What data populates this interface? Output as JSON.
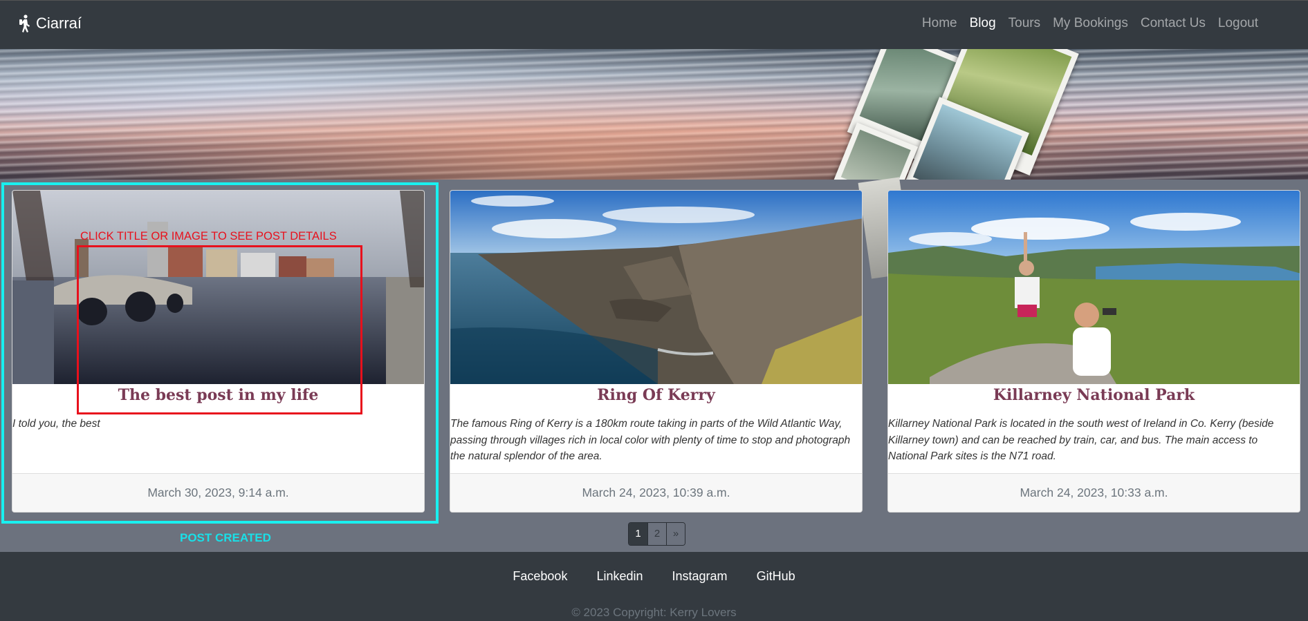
{
  "navbar": {
    "brand": "Ciarraí",
    "links": [
      {
        "label": "Home",
        "active": false
      },
      {
        "label": "Blog",
        "active": true
      },
      {
        "label": "Tours",
        "active": false
      },
      {
        "label": "My Bookings",
        "active": false
      },
      {
        "label": "Contact Us",
        "active": false
      },
      {
        "label": "Logout",
        "active": false
      }
    ]
  },
  "posts": [
    {
      "title": "The best post in my life",
      "excerpt": "I told you, the best",
      "date": "March 30, 2023, 9:14 a.m.",
      "image": "dublin-river-bridge"
    },
    {
      "title": "Ring Of Kerry",
      "excerpt": "The famous Ring of Kerry is a 180km route taking in parts of the Wild Atlantic Way, passing through villages rich in local color with plenty of time to stop and photograph the natural splendor of the area.",
      "date": "March 24, 2023, 10:39 a.m.",
      "image": "coastal-cliffs"
    },
    {
      "title": "Killarney National Park",
      "excerpt": "Killarney National Park is located in the south west of Ireland in Co. Kerry (beside Killarney town) and can be reached by train, car, and bus. The main access to National Park sites is the N71 road.",
      "date": "March 24, 2023, 10:33 a.m.",
      "image": "mountain-selfie"
    }
  ],
  "annotations": {
    "click_hint": "CLICK TITLE OR IMAGE TO SEE POST DETAILS",
    "post_created": "POST CREATED"
  },
  "pagination": {
    "current": "1",
    "next_page": "2",
    "next_arrow": "»"
  },
  "footer": {
    "links": [
      "Facebook",
      "Linkedin",
      "Instagram",
      "GitHub"
    ],
    "copyright": "© 2023 Copyright: Kerry Lovers"
  },
  "colors": {
    "navbar_bg": "#343a40",
    "page_bg": "#6c727e",
    "title_color": "#7a3b55",
    "annotation_cyan": "#19f0f0",
    "annotation_red": "#e8101c"
  }
}
